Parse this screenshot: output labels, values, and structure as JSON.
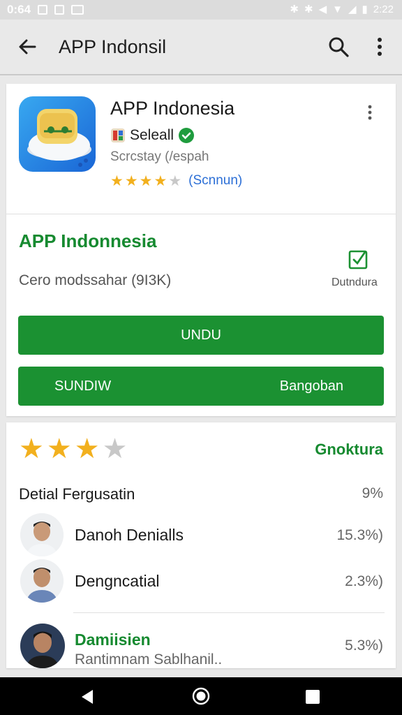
{
  "status_bar": {
    "left_text": "0:64",
    "time": "2:22",
    "left_icons": [
      "w-notification-icon",
      "photo-notification-icon",
      "message-notification-icon"
    ],
    "right_icons": [
      "bluetooth-icon",
      "vibrate-icon",
      "volume-icon",
      "wifi-icon",
      "signal-icon",
      "battery-icon"
    ]
  },
  "app_bar": {
    "title": "APP Indonsil",
    "back_icon": "arrow-back-icon",
    "search_icon": "search-icon",
    "menu_icon": "more-vert-icon"
  },
  "app_header": {
    "name": "APP Indonesia",
    "developer": "Seleall",
    "category": "Scrcstay (/espah",
    "rating": 4.5,
    "rating_count": "(Scnnun)"
  },
  "install_section": {
    "title": "APP Indonnesia",
    "size_text": "Cero modssahar (9I3K)",
    "download_label": "Dutndura",
    "primary_button": "UNDU",
    "secondary_button_left": "SUNDIW",
    "secondary_button_right": "Bangoban"
  },
  "reviews": {
    "overall_rating": 3.5,
    "link_label": "Gnoktura",
    "detail_label": "Detial Fergusatin",
    "detail_value": "9%",
    "items": [
      {
        "name": "Danoh Denialls",
        "sub": "",
        "value": "15.3%)"
      },
      {
        "name": "Dengncatial",
        "sub": "",
        "value": "2.3%)"
      },
      {
        "name": "Damiisien",
        "sub": "Rantimnam Sablhanil..",
        "value": "5.3%)"
      }
    ]
  },
  "colors": {
    "accent_green": "#1b9132",
    "star_yellow": "#f2b01e",
    "link_blue": "#2c6fd6"
  },
  "nav_bar": {
    "icons": [
      "nav-back-icon",
      "nav-home-icon",
      "nav-recents-icon"
    ]
  }
}
